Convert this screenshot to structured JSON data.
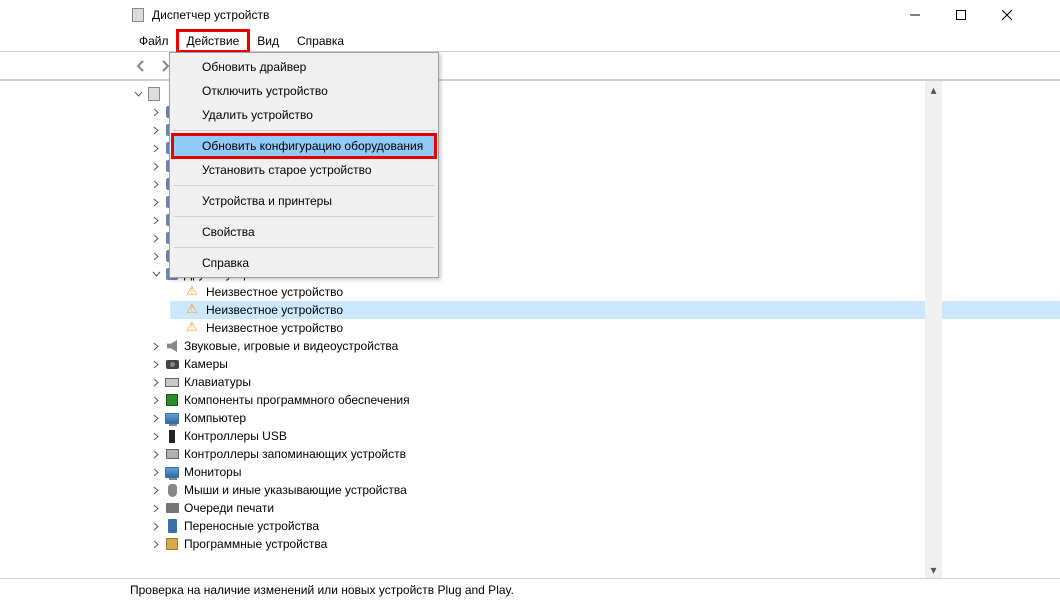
{
  "window": {
    "title": "Диспетчер устройств"
  },
  "menubar": {
    "items": [
      {
        "label": "Файл"
      },
      {
        "label": "Действие",
        "highlighted": true
      },
      {
        "label": "Вид"
      },
      {
        "label": "Справка"
      }
    ]
  },
  "dropdown": {
    "items": [
      {
        "label": "Обновить драйвер"
      },
      {
        "label": "Отключить устройство"
      },
      {
        "label": "Удалить устройство"
      },
      {
        "sep": true
      },
      {
        "label": "Обновить конфигурацию оборудования",
        "hovered": true,
        "highlighted": true
      },
      {
        "label": "Установить старое устройство"
      },
      {
        "sep": true
      },
      {
        "label": "Устройства и принтеры"
      },
      {
        "sep": true
      },
      {
        "label": "Свойства"
      },
      {
        "sep": true
      },
      {
        "label": "Справка"
      }
    ]
  },
  "tree": {
    "root_expanded": true,
    "root_icon": "pc",
    "children": [
      {
        "icon": "generic",
        "expandable": true
      },
      {
        "icon": "generic",
        "expandable": true
      },
      {
        "icon": "generic",
        "expandable": true
      },
      {
        "icon": "generic",
        "expandable": true
      },
      {
        "icon": "generic",
        "expandable": true
      },
      {
        "icon": "generic",
        "expandable": true
      },
      {
        "icon": "generic",
        "expandable": true
      },
      {
        "icon": "generic",
        "expandable": true
      },
      {
        "icon": "generic",
        "expandable": true
      },
      {
        "icon": "other",
        "label": "Другие устройства",
        "expanded": true,
        "children": [
          {
            "icon": "warn",
            "label": "Неизвестное устройство"
          },
          {
            "icon": "warn",
            "label": "Неизвестное устройство",
            "selected": true
          },
          {
            "icon": "warn",
            "label": "Неизвестное устройство"
          }
        ]
      },
      {
        "icon": "audio",
        "label": "Звуковые, игровые и видеоустройства",
        "expandable": true
      },
      {
        "icon": "camera",
        "label": "Камеры",
        "expandable": true
      },
      {
        "icon": "keyboard",
        "label": "Клавиатуры",
        "expandable": true
      },
      {
        "icon": "chip",
        "label": "Компоненты программного обеспечения",
        "expandable": true
      },
      {
        "icon": "monitor",
        "label": "Компьютер",
        "expandable": true
      },
      {
        "icon": "usb",
        "label": "Контроллеры USB",
        "expandable": true
      },
      {
        "icon": "storage",
        "label": "Контроллеры запоминающих устройств",
        "expandable": true
      },
      {
        "icon": "monitor",
        "label": "Мониторы",
        "expandable": true
      },
      {
        "icon": "mouse",
        "label": "Мыши и иные указывающие устройства",
        "expandable": true
      },
      {
        "icon": "printer",
        "label": "Очереди печати",
        "expandable": true
      },
      {
        "icon": "portable",
        "label": "Переносные устройства",
        "expandable": true
      },
      {
        "icon": "soft",
        "label": "Программные устройства",
        "expandable": true
      }
    ]
  },
  "statusbar": {
    "text": "Проверка на наличие изменений или новых устройств Plug and Play."
  }
}
